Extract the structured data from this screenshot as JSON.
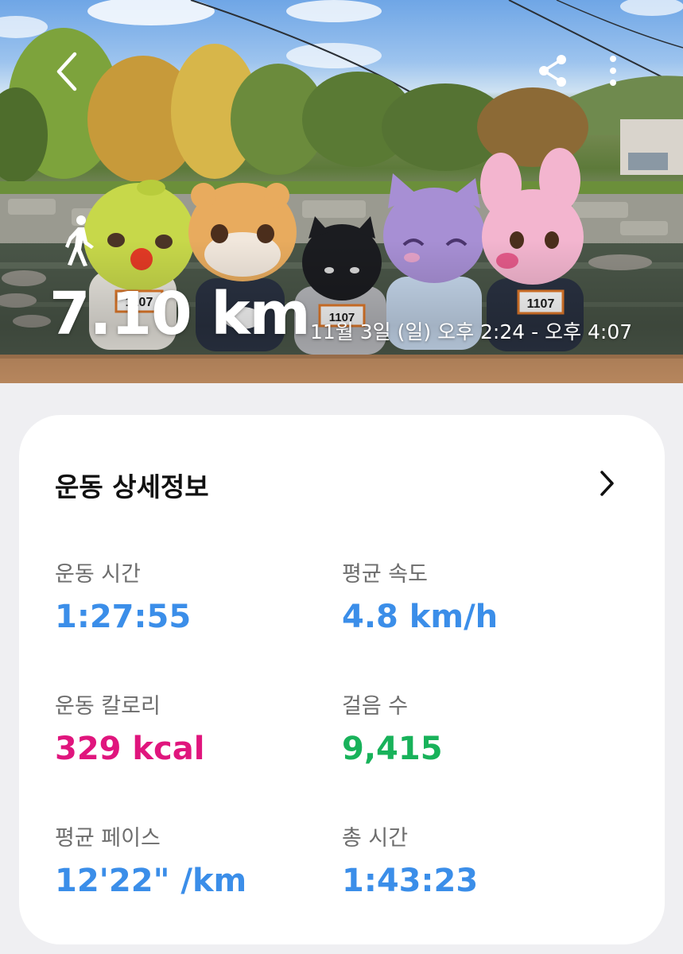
{
  "header": {
    "distance": "7.10 km",
    "time_range": "11월 3일 (일) 오후 2:24 - 오후 4:07",
    "icons": {
      "back": "back-arrow-icon",
      "share": "share-icon",
      "more": "more-vertical-icon",
      "activity": "walking-person-icon"
    },
    "photo_badge_text": "1107"
  },
  "details": {
    "title": "운동 상세정보",
    "stats": [
      {
        "label": "운동 시간",
        "value": "1:27:55",
        "color": "#3b8ee9"
      },
      {
        "label": "평균 속도",
        "value": "4.8 km/h",
        "color": "#3b8ee9"
      },
      {
        "label": "운동 칼로리",
        "value": "329 kcal",
        "color": "#e0157d"
      },
      {
        "label": "걸음 수",
        "value": "9,415",
        "color": "#18b25a"
      },
      {
        "label": "평균 페이스",
        "value": "12'22\" /km",
        "color": "#3b8ee9"
      },
      {
        "label": "총 시간",
        "value": "1:43:23",
        "color": "#3b8ee9"
      }
    ]
  },
  "colors": {
    "accent_blue": "#3b8ee9",
    "calorie_magenta": "#e0157d",
    "steps_green": "#18b25a",
    "page_background": "#efeff2"
  }
}
